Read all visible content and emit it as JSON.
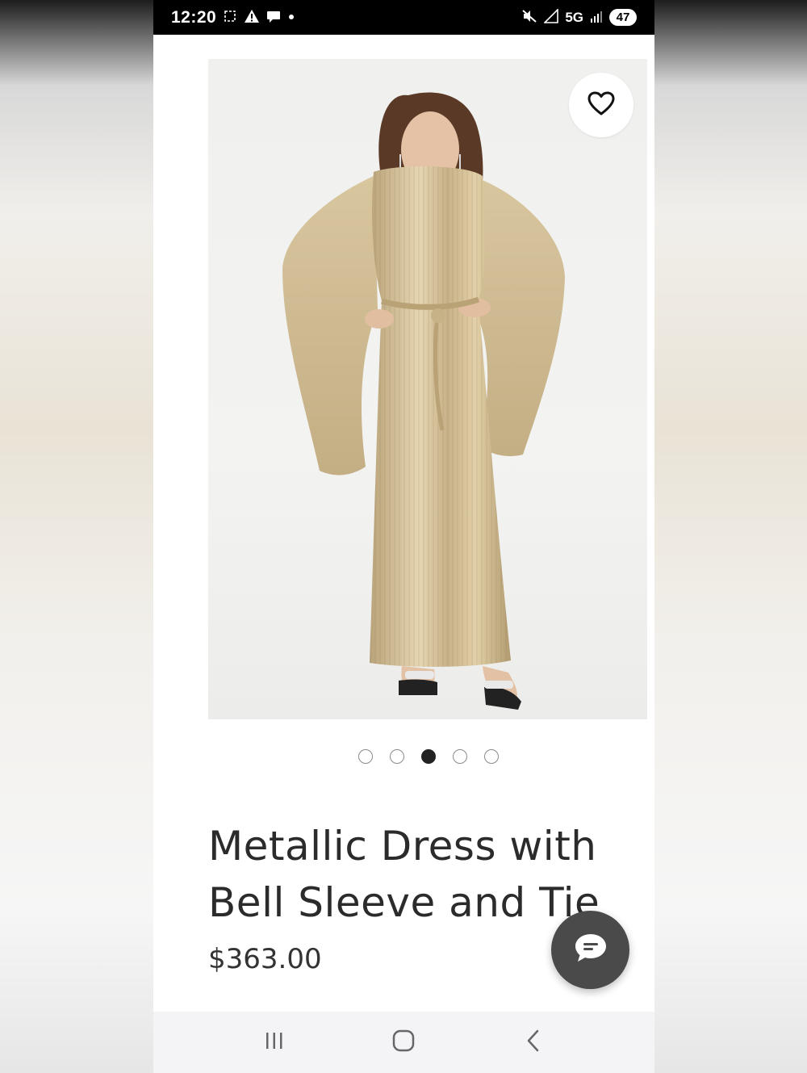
{
  "status_bar": {
    "time": "12:20",
    "network": "5G",
    "battery": "47",
    "icons": [
      "screenshot-icon",
      "alert-icon",
      "chat-bubble-icon",
      "dot-icon",
      "mute-icon",
      "signal-icon"
    ]
  },
  "product": {
    "title": "Metallic Dress with Bell Sleeve and Tie",
    "price": "$363.00",
    "image_alt": "model-wearing-gold-metallic-dress",
    "gallery": {
      "count": 5,
      "active_index": 2
    }
  },
  "colors": {
    "dress_gold": "#c9b48a",
    "dot_active": "#222222",
    "chat_button": "#4a4a4a",
    "status_bar": "#000000"
  },
  "nav_bar": {
    "icons": [
      "recent-apps-icon",
      "home-icon",
      "back-icon"
    ]
  }
}
